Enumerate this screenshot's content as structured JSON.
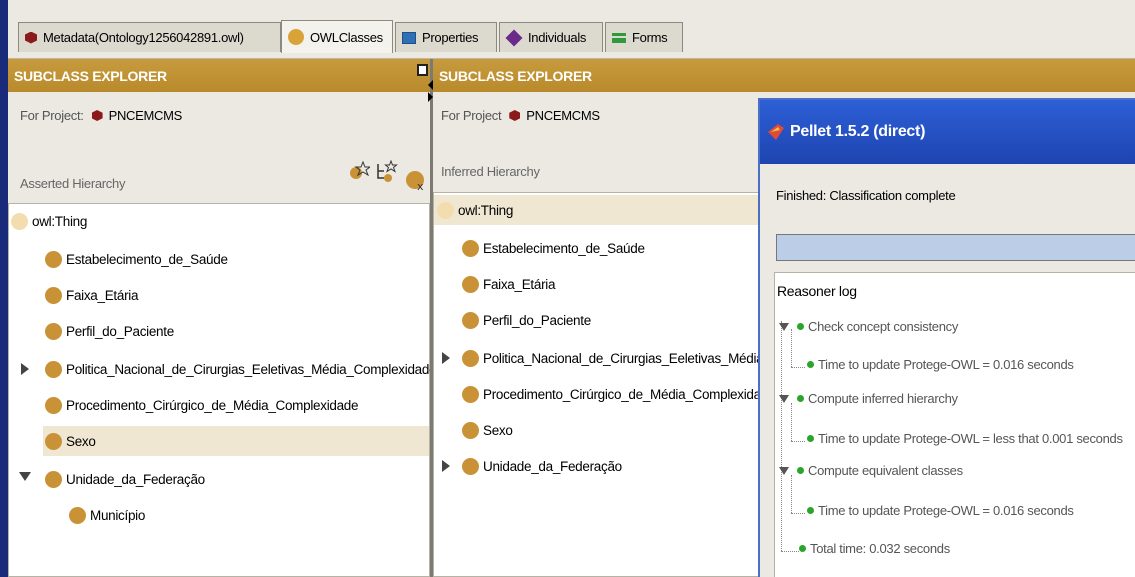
{
  "tabs": [
    {
      "label": "Metadata(Ontology1256042891.owl)",
      "icon": "metadata-icon",
      "color": "#8b1a1a"
    },
    {
      "label": "OWLClasses",
      "icon": "owl-class-icon",
      "color": "#d9a33a",
      "active": true
    },
    {
      "label": "Properties",
      "icon": "properties-icon",
      "color": "#2f6fb3"
    },
    {
      "label": "Individuals",
      "icon": "individuals-icon",
      "color": "#6a2a8a"
    },
    {
      "label": "Forms",
      "icon": "forms-icon",
      "color": "#2f9a3a"
    }
  ],
  "left": {
    "header": "SUBCLASS EXPLORER",
    "project_label": "For Project:",
    "project_name": "PNCEMCMS",
    "hierarchy_label": "Asserted Hierarchy",
    "toolbar_icons": [
      "create-subclass-icon",
      "create-sibling-icon",
      "delete-class-icon"
    ],
    "tree": [
      {
        "label": "owl:Thing"
      },
      {
        "label": "Estabelecimento_de_Saúde"
      },
      {
        "label": "Faixa_Etária"
      },
      {
        "label": "Perfil_do_Paciente"
      },
      {
        "label": "Politica_Nacional_de_Cirurgias_Eeletivas_Média_Complexidade",
        "expand": "collapsed"
      },
      {
        "label": "Procedimento_Cirúrgico_de_Média_Complexidade"
      },
      {
        "label": "Sexo",
        "selected": true
      },
      {
        "label": "Unidade_da_Federação",
        "expand": "expanded"
      },
      {
        "label": "Município"
      }
    ]
  },
  "right": {
    "header": "SUBCLASS EXPLORER",
    "project_label": "For Project",
    "project_name": "PNCEMCMS",
    "hierarchy_label": "Inferred Hierarchy",
    "tree": [
      {
        "label": "owl:Thing",
        "selected": true
      },
      {
        "label": "Estabelecimento_de_Saúde"
      },
      {
        "label": "Faixa_Etária"
      },
      {
        "label": "Perfil_do_Paciente"
      },
      {
        "label": "Politica_Nacional_de_Cirurgias_Eeletivas_Média_",
        "expand": "collapsed"
      },
      {
        "label": "Procedimento_Cirúrgico_de_Média_Complexidade"
      },
      {
        "label": "Sexo"
      },
      {
        "label": "Unidade_da_Federação",
        "expand": "collapsed"
      }
    ]
  },
  "dialog": {
    "title": "Pellet 1.5.2 (direct)",
    "status": "Finished: Classification complete",
    "progress": 1.0,
    "log_label": "Reasoner log",
    "log": [
      {
        "text": "Check concept consistency"
      },
      {
        "text": "Time to update Protege-OWL = 0.016 seconds"
      },
      {
        "text": "Compute inferred hierarchy"
      },
      {
        "text": "Time to update Protege-OWL = less that 0.001 seconds"
      },
      {
        "text": "Compute equivalent classes"
      },
      {
        "text": "Time to update Protege-OWL = 0.016 seconds"
      },
      {
        "text": "Total time: 0.032 seconds"
      }
    ]
  }
}
